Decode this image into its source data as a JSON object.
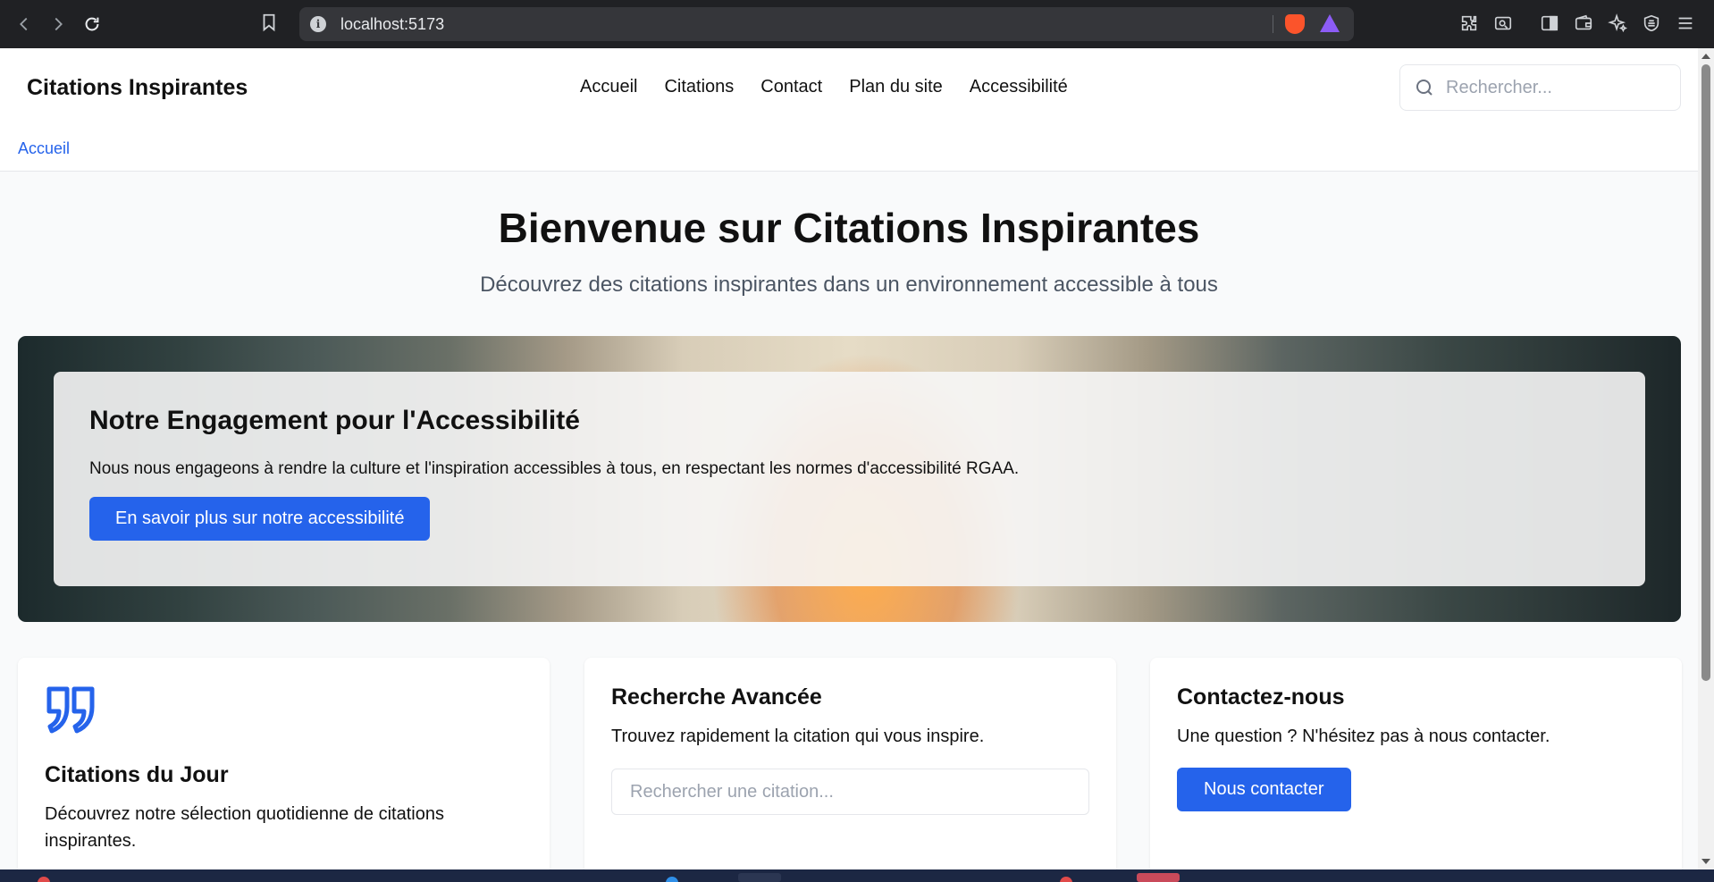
{
  "browser": {
    "url": "localhost:5173",
    "icons": [
      "back-icon",
      "forward-icon",
      "reload-icon",
      "bookmark-icon",
      "site-info-icon",
      "brave-shields-icon",
      "brave-rewards-icon",
      "extensions-icon",
      "screenshot-icon",
      "sidebar-icon",
      "wallet-icon",
      "leo-ai-icon",
      "vpn-icon",
      "menu-icon"
    ]
  },
  "header": {
    "logo": "Citations Inspirantes",
    "nav": [
      "Accueil",
      "Citations",
      "Contact",
      "Plan du site",
      "Accessibilité"
    ],
    "search_placeholder": "Rechercher...",
    "breadcrumb": "Accueil"
  },
  "hero": {
    "title": "Bienvenue sur Citations Inspirantes",
    "subtitle": "Découvrez des citations inspirantes dans un environnement accessible à tous"
  },
  "banner": {
    "title": "Notre Engagement pour l'Accessibilité",
    "text": "Nous nous engageons à rendre la culture et l'inspiration accessibles à tous, en respectant les normes d'accessibilité RGAA.",
    "button": "En savoir plus sur notre accessibilité"
  },
  "cards": [
    {
      "title": "Citations du Jour",
      "text": "Découvrez notre sélection quotidienne de citations inspirantes.",
      "icon": "quote-icon"
    },
    {
      "title": "Recherche Avancée",
      "text": "Trouvez rapidement la citation qui vous inspire.",
      "input_placeholder": "Rechercher une citation..."
    },
    {
      "title": "Contactez-nous",
      "text": "Une question ? N'hésitez pas à nous contacter.",
      "button": "Nous contacter"
    }
  ],
  "colors": {
    "accent": "#2563eb",
    "chrome": "#202124",
    "page_bg": "#f9fafb"
  }
}
